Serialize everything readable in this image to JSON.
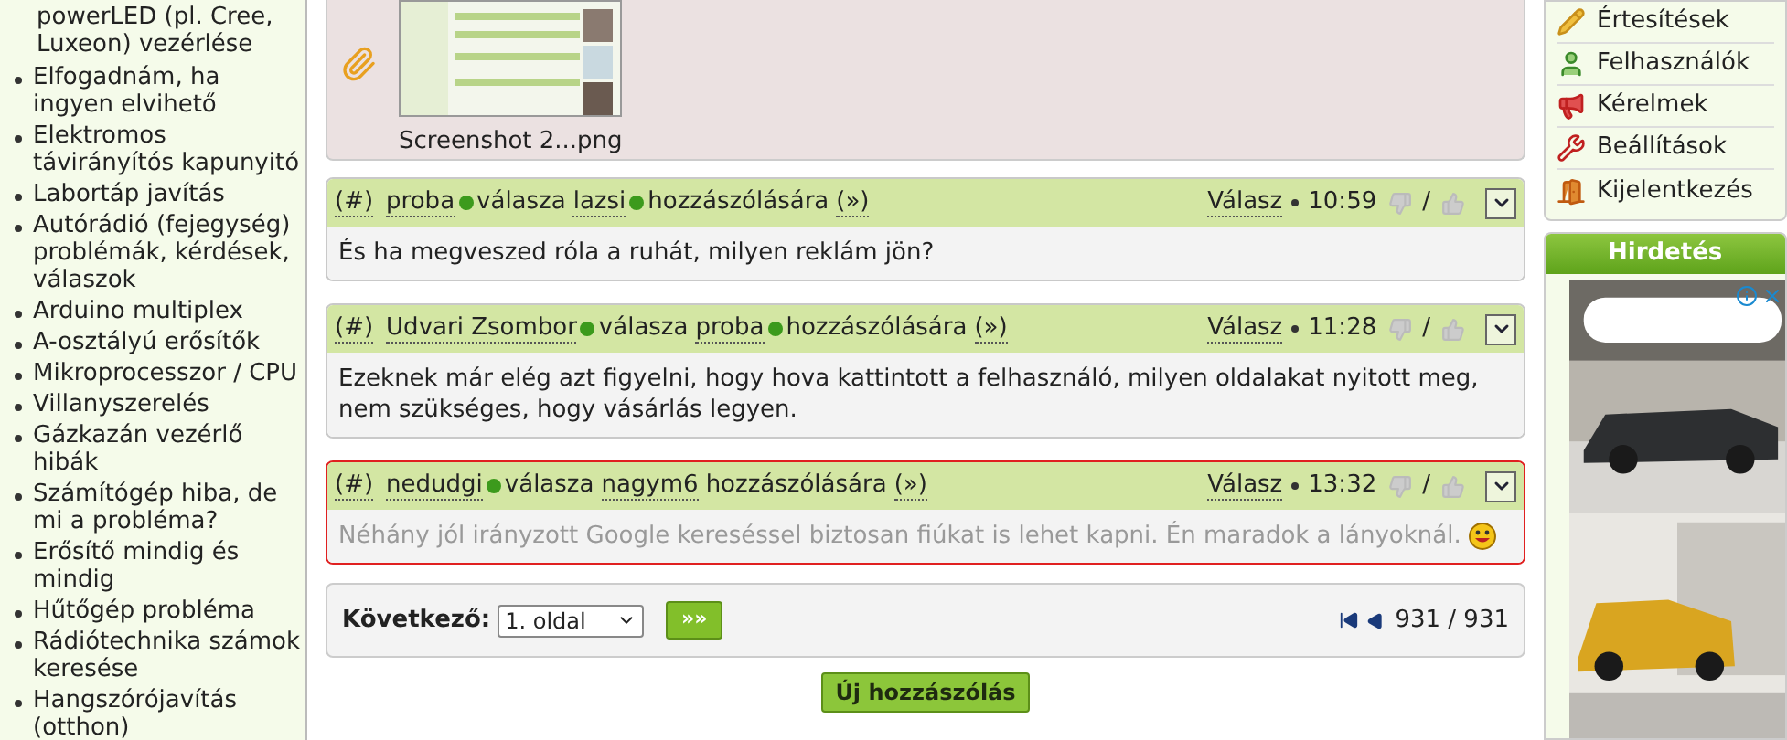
{
  "left_sidebar": {
    "cut_item": "powerLED (pl. Cree, Luxeon) vezérlése",
    "items": [
      "Elfogadnám, ha ingyen elvihető",
      "Elektromos távirányítós kapunyitó",
      "Labortáp javítás",
      "Autórádió (fejegység) problémák, kérdések, válaszok",
      "Arduino multiplex",
      "A-osztályú erősítők",
      "Mikroprocesszor / CPU",
      "Villanyszerelés",
      "Gázkazán vezérlő hibák",
      "Számítógép hiba, de mi a probléma?",
      "Erősítő mindig és mindig",
      "Hűtőgép probléma",
      "Rádiótechnika számok keresése",
      "Hangszórójavítás (otthon)"
    ]
  },
  "attachment": {
    "filename": "Screenshot 2...png"
  },
  "comments": [
    {
      "hash": "(#)",
      "author": "proba",
      "author_online": true,
      "verb": "válasza",
      "reply_to": "lazsi",
      "reply_to_online": true,
      "suffix": "hozzászólására",
      "link": "(»)",
      "reply": "Válasz",
      "time": "10:59",
      "separator": "/",
      "body": "És ha megveszed róla a ruhát, milyen reklám jön?",
      "highlighted": false,
      "muted": false,
      "smiley": false
    },
    {
      "hash": "(#)",
      "author": "Udvari Zsombor",
      "author_online": true,
      "verb": "válasza",
      "reply_to": "proba",
      "reply_to_online": true,
      "suffix": "hozzászólására",
      "link": "(»)",
      "reply": "Válasz",
      "time": "11:28",
      "separator": "/",
      "body": "Ezeknek már elég azt figyelni, hogy hova kattintott a felhasználó, milyen oldalakat nyitott meg, nem szükséges, hogy vásárlás legyen.",
      "highlighted": false,
      "muted": false,
      "smiley": false
    },
    {
      "hash": "(#)",
      "author": "nedudgi",
      "author_online": true,
      "verb": "válasza",
      "reply_to": "nagym6",
      "reply_to_online": false,
      "suffix": "hozzászólására",
      "link": "(»)",
      "reply": "Válasz",
      "time": "13:32",
      "separator": "/",
      "body": "Néhány jól irányzott Google kereséssel biztosan fiúkat is lehet kapni. Én maradok a lányoknál.",
      "highlighted": true,
      "muted": true,
      "smiley": true
    }
  ],
  "pagination": {
    "label": "Következő:",
    "page_select": "1. oldal",
    "go_button": "»»",
    "count": "931 / 931"
  },
  "new_post_button": "Új hozzászólás",
  "right_menu": {
    "items": [
      "Értesítések",
      "Felhasználók",
      "Kérelmek",
      "Beállítások",
      "Kijelentkezés"
    ]
  },
  "ad": {
    "title": "Hirdetés"
  }
}
